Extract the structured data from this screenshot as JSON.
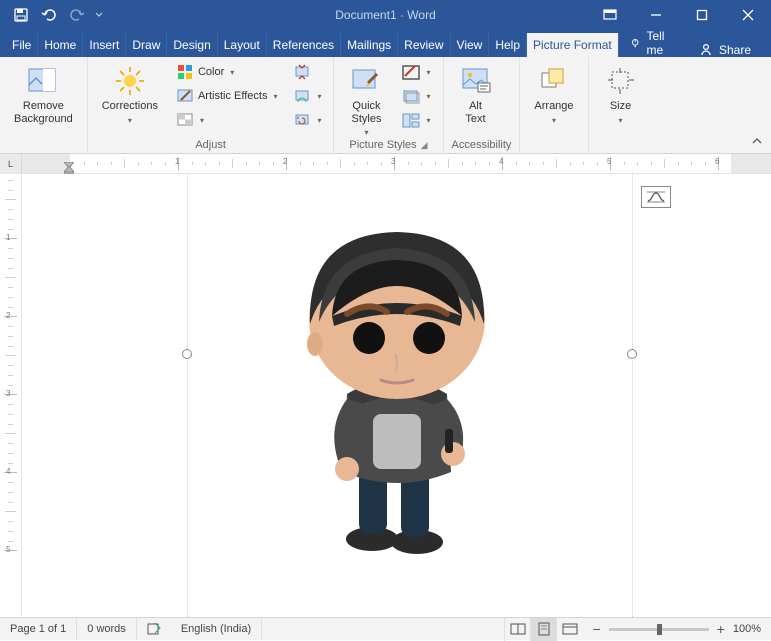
{
  "titlebar": {
    "title_doc": "Document1",
    "title_app": "Word"
  },
  "tabs": {
    "items": [
      "File",
      "Home",
      "Insert",
      "Draw",
      "Design",
      "Layout",
      "References",
      "Mailings",
      "Review",
      "View",
      "Help",
      "Picture Format"
    ],
    "active": 11,
    "tellme": "Tell me",
    "share": "Share"
  },
  "ribbon": {
    "remove_bg": "Remove\nBackground",
    "adjust": {
      "corrections": "Corrections",
      "color": "Color",
      "artistic": "Artistic Effects",
      "label": "Adjust"
    },
    "picstyles": {
      "quick": "Quick\nStyles",
      "label": "Picture Styles"
    },
    "access": {
      "alt": "Alt\nText",
      "label": "Accessibility"
    },
    "arrange": {
      "label_btn": "Arrange",
      "label": ""
    },
    "size": {
      "label_btn": "Size",
      "label": ""
    }
  },
  "ruler": {
    "nums": [
      "1",
      "2",
      "3",
      "4",
      "5",
      "6"
    ]
  },
  "ruler_v": {
    "nums": [
      "1",
      "2",
      "3",
      "4",
      "5"
    ]
  },
  "status": {
    "page": "Page 1 of 1",
    "words": "0 words",
    "lang": "English (India)",
    "zoom": "100%"
  }
}
